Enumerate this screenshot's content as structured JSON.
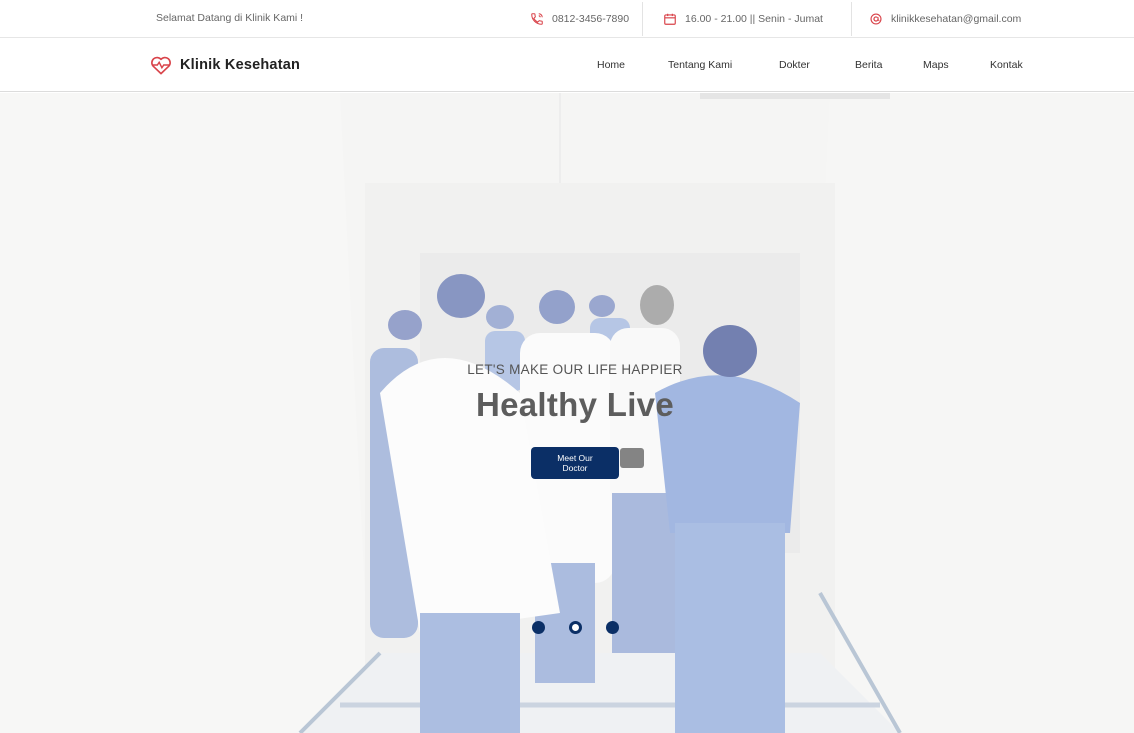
{
  "topbar": {
    "welcome": "Selamat Datang di Klinik Kami !",
    "phone": "0812-3456-7890",
    "hours": "16.00 - 21.00 || Senin - Jumat",
    "email": "klinikkesehatan@gmail.com",
    "icons": [
      "phone-icon",
      "calendar-icon",
      "mail-icon"
    ]
  },
  "nav": {
    "brand": "Klinik Kesehatan",
    "brand_icon": "heart-pulse-icon",
    "items": [
      {
        "label": "Home"
      },
      {
        "label": "Tentang Kami"
      },
      {
        "label": "Dokter"
      },
      {
        "label": "Berita"
      },
      {
        "label": "Maps"
      },
      {
        "label": "Kontak"
      }
    ]
  },
  "hero": {
    "eyebrow": "LET'S MAKE OUR LIFE HAPPIER",
    "headline": "Healthy Live",
    "cta": "Meet Our Doctor",
    "slides": [
      {
        "state": "filled"
      },
      {
        "state": "active"
      },
      {
        "state": "filled"
      }
    ]
  },
  "colors": {
    "accent": "#0b2f66",
    "icon_red": "#d9434a",
    "text": "#333333"
  }
}
